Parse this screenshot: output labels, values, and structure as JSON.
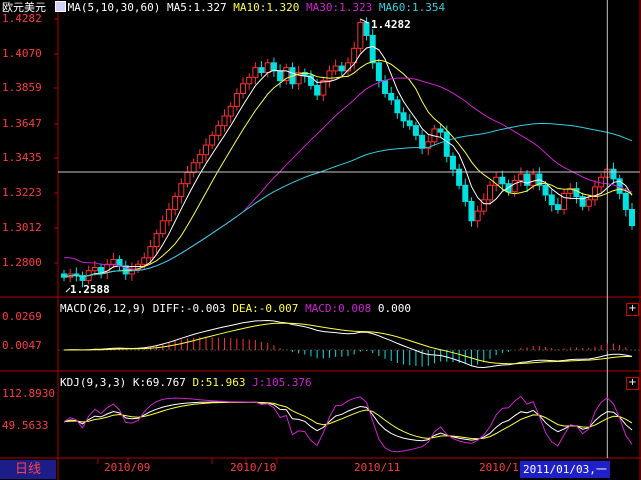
{
  "header": {
    "symbol": "欧元美元",
    "ma_params": "MA(5,10,30,60)",
    "ma5": "MA5:1.327",
    "ma10": "MA10:1.320",
    "ma30": "MA30:1.323",
    "ma60": "MA60:1.354"
  },
  "price_axis": [
    "1.4282",
    "1.4070",
    "1.3859",
    "1.3647",
    "1.3435",
    "1.3223",
    "1.3012",
    "1.2800"
  ],
  "price_annotations": {
    "high": "1.4282",
    "low": "1.2588"
  },
  "macd_header": {
    "params": "MACD(26,12,9)",
    "diff": "DIFF:-0.003",
    "dea": "DEA:-0.007",
    "macd": "MACD:0.008",
    "extra": "0.000"
  },
  "macd_axis": [
    "0.0269",
    "0.0047"
  ],
  "kdj_header": {
    "params": "KDJ(9,3,3)",
    "k": "K:69.767",
    "d": "D:51.963",
    "j": "J:105.376"
  },
  "kdj_axis": [
    "112.8930",
    "49.5633"
  ],
  "x_axis": [
    "2010/09",
    "2010/10",
    "2010/11",
    "2010/1"
  ],
  "period_tab": "日线",
  "cursor_date": "2011/01/03,一",
  "colors": {
    "up": "#ff3030",
    "down": "#00e0e0",
    "ma5": "#ffffff",
    "ma10": "#ffff40",
    "ma30": "#d020d0",
    "ma60": "#30d0e0",
    "axis": "#b00000"
  },
  "chart_data": {
    "type": "candlestick",
    "series_note": "",
    "price_range": [
      1.2588,
      1.4282
    ],
    "closes": [
      1.268,
      1.27,
      1.269,
      1.266,
      1.272,
      1.274,
      1.271,
      1.276,
      1.279,
      1.275,
      1.27,
      1.273,
      1.276,
      1.28,
      1.287,
      1.295,
      1.303,
      1.31,
      1.318,
      1.326,
      1.333,
      1.339,
      1.344,
      1.35,
      1.356,
      1.362,
      1.368,
      1.374,
      1.382,
      1.388,
      1.392,
      1.398,
      1.395,
      1.401,
      1.396,
      1.39,
      1.398,
      1.388,
      1.395,
      1.393,
      1.387,
      1.381,
      1.39,
      1.396,
      1.399,
      1.396,
      1.401,
      1.41,
      1.426,
      1.418,
      1.401,
      1.39,
      1.382,
      1.378,
      1.37,
      1.365,
      1.362,
      1.356,
      1.348,
      1.352,
      1.36,
      1.358,
      1.343,
      1.335,
      1.325,
      1.315,
      1.303,
      1.309,
      1.316,
      1.325,
      1.33,
      1.326,
      1.321,
      1.328,
      1.332,
      1.325,
      1.332,
      1.325,
      1.319,
      1.313,
      1.31,
      1.32,
      1.323,
      1.318,
      1.312,
      1.316,
      1.324,
      1.33,
      1.335,
      1.329,
      1.32,
      1.31,
      1.3
    ]
  }
}
